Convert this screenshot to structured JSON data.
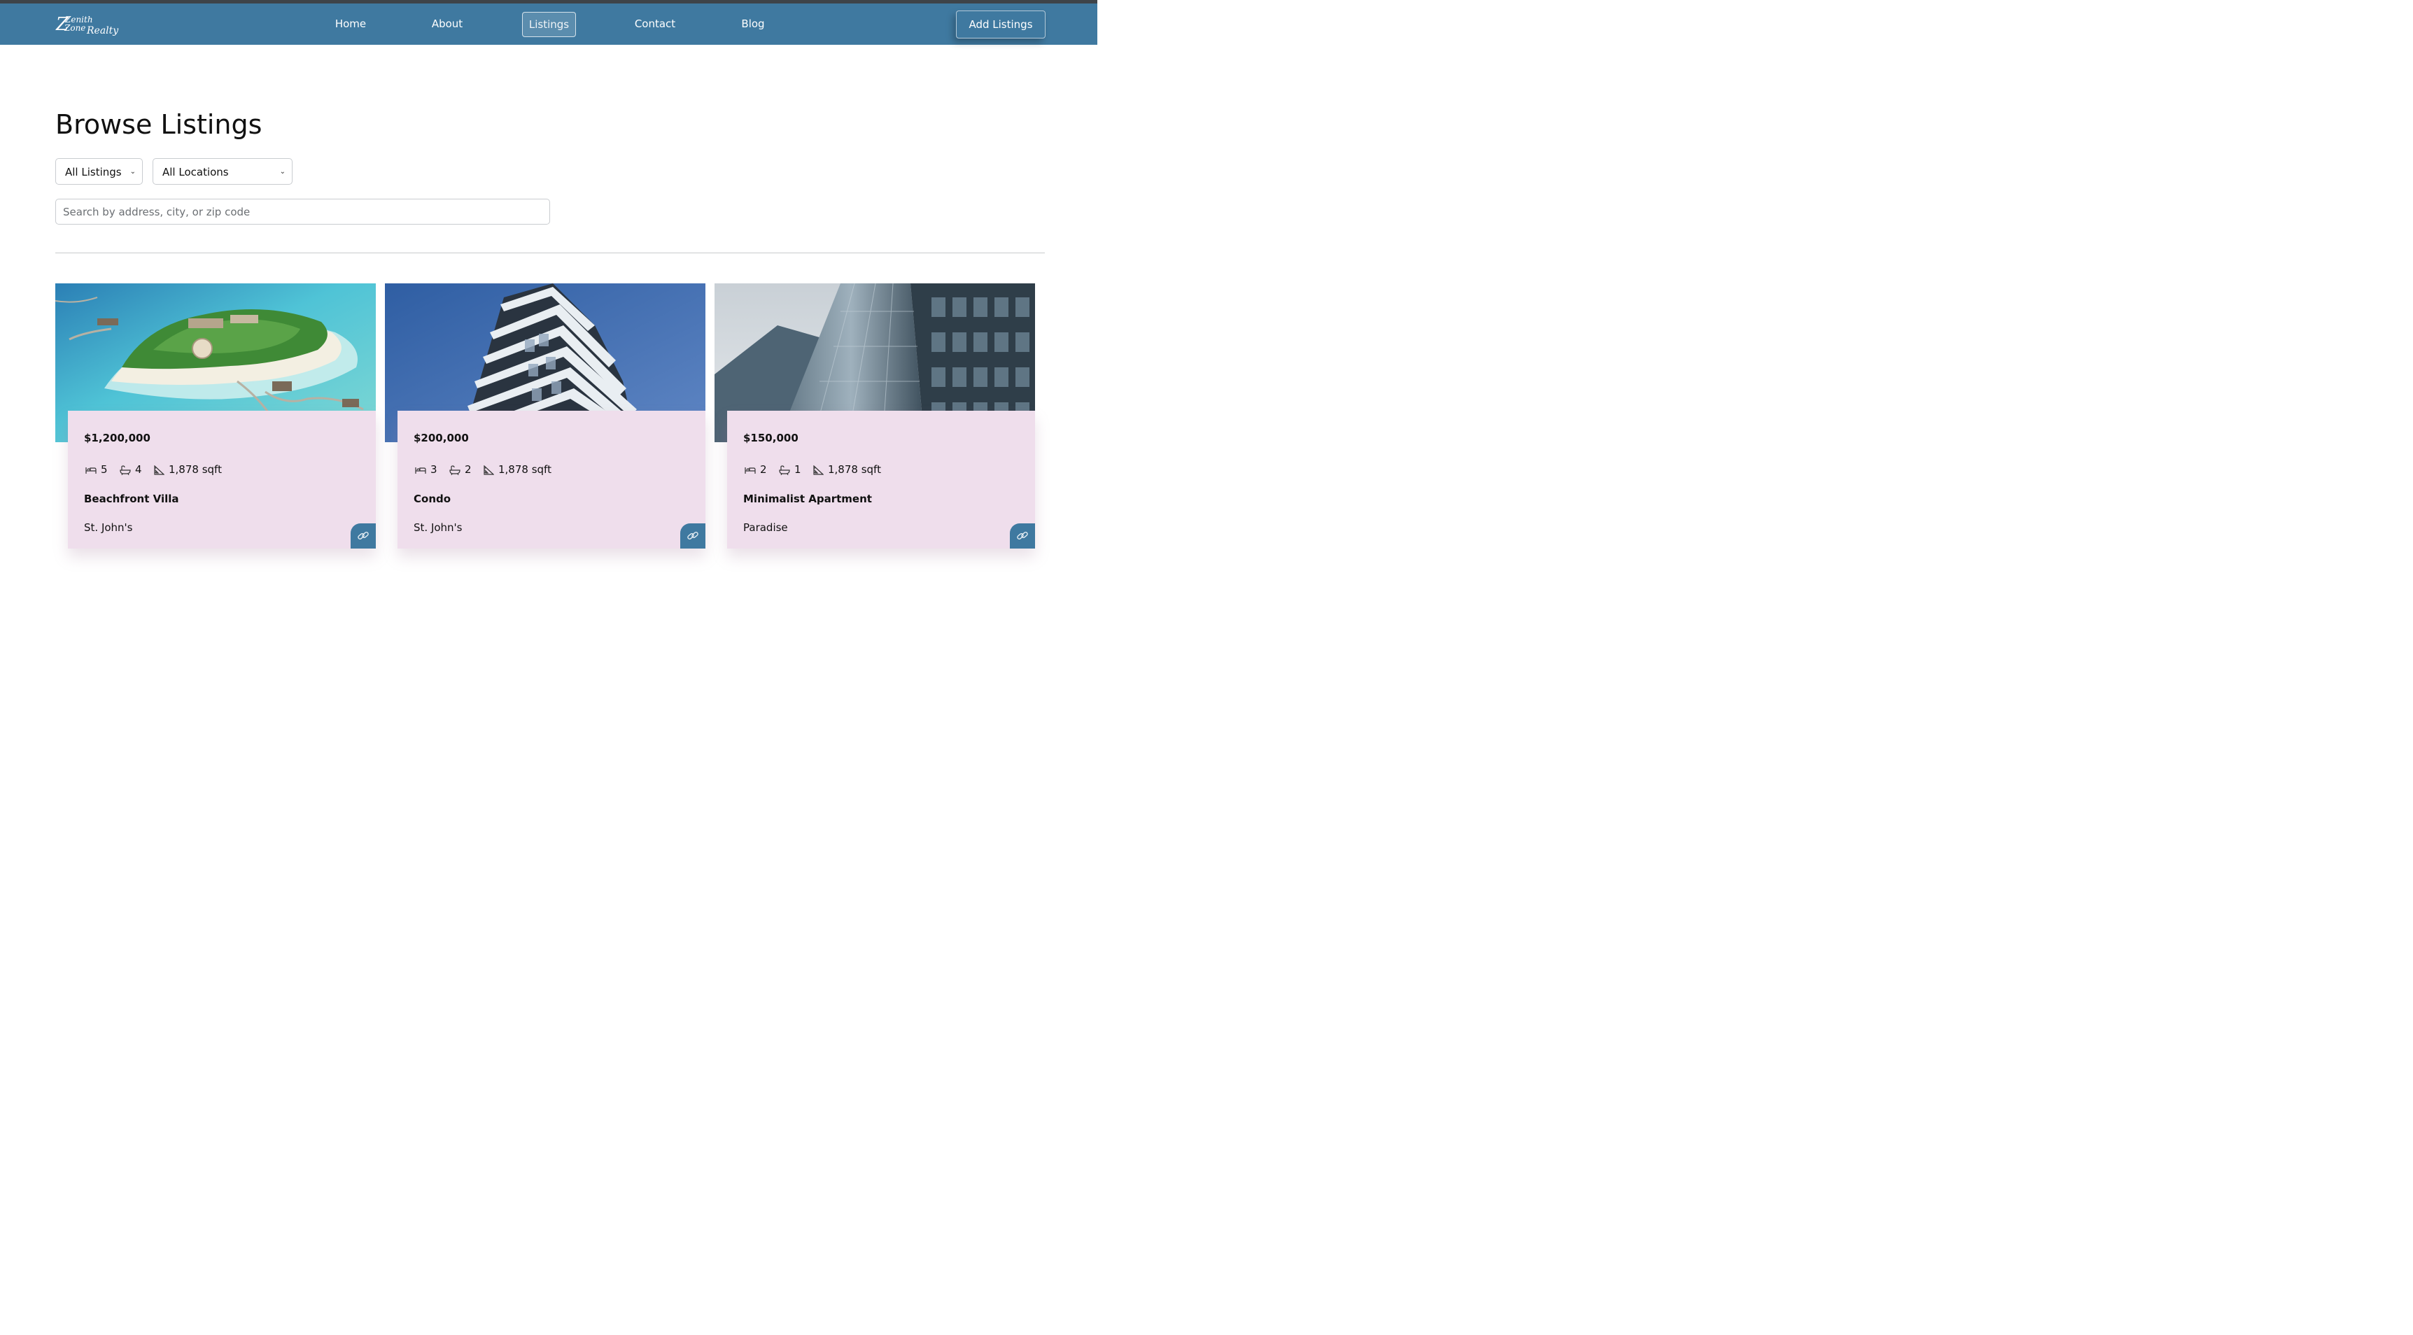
{
  "brand": {
    "logo_top": "Zenith",
    "logo_line2": "Zone",
    "logo_realty": "Realty"
  },
  "nav": {
    "items": [
      {
        "label": "Home"
      },
      {
        "label": "About"
      },
      {
        "label": "Listings",
        "active": true
      },
      {
        "label": "Contact"
      },
      {
        "label": "Blog"
      }
    ],
    "add_button": "Add Listings"
  },
  "main": {
    "title": "Browse Listings",
    "filters": {
      "type_selected": "All Listings",
      "location_selected": "All Locations"
    },
    "search": {
      "placeholder": "Search by address, city, or zip code",
      "value": ""
    }
  },
  "listings": [
    {
      "price": "$1,200,000",
      "beds": "5",
      "baths": "4",
      "area": "1,878 sqft",
      "title": "Beachfront Villa",
      "location": "St. John's"
    },
    {
      "price": "$200,000",
      "beds": "3",
      "baths": "2",
      "area": "1,878 sqft",
      "title": "Condo",
      "location": "St. John's"
    },
    {
      "price": "$150,000",
      "beds": "2",
      "baths": "1",
      "area": "1,878 sqft",
      "title": "Minimalist Apartment",
      "location": "Paradise"
    }
  ],
  "colors": {
    "nav_bg": "#3f79a0",
    "card_bg": "#efdeec",
    "accent": "#3f79a0"
  }
}
